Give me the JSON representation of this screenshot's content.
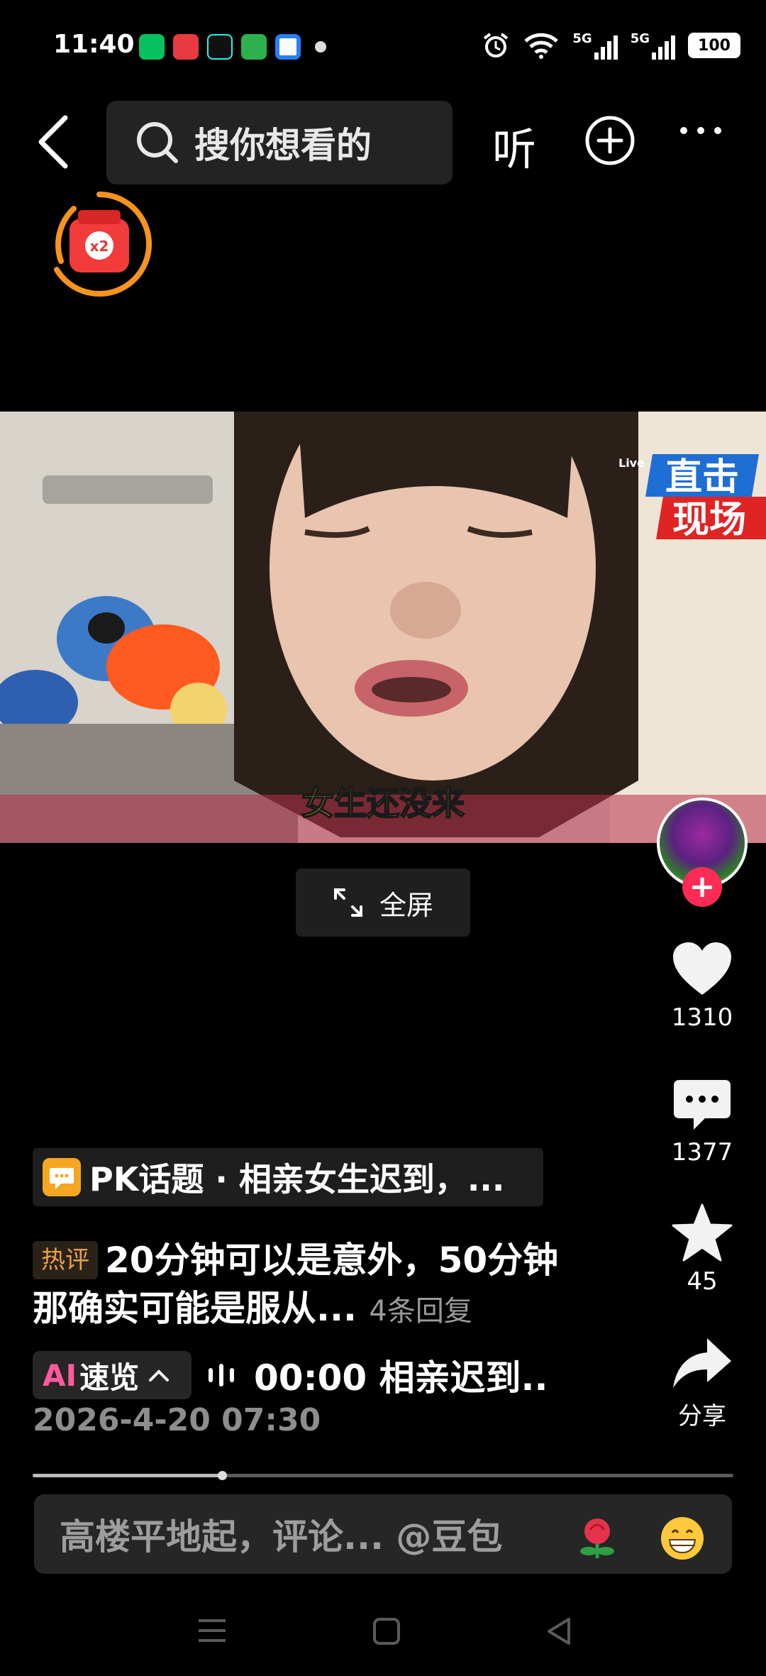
{
  "status_bar": {
    "time": "11:40",
    "battery": "100",
    "network_1": "5G",
    "network_2": "5G"
  },
  "top_nav": {
    "search_label": "搜你想看的",
    "listen_label": "听"
  },
  "redpacket": {
    "multiplier": "x2"
  },
  "video": {
    "caption": "女生还没来",
    "banner_line1": "直击",
    "banner_line2": "现场",
    "live_tag": "Live"
  },
  "fullscreen": {
    "label": "全屏"
  },
  "rail": {
    "likes": "1310",
    "comments": "1377",
    "favorites": "45",
    "share_label": "分享"
  },
  "info": {
    "topic": "PK话题 · 相亲女生迟到，...",
    "hot_badge": "热评",
    "hot_comment": "20分钟可以是意外，50分钟那确实可能是服从...",
    "reply_count": "4条回复",
    "ai_label": "AI",
    "ai_text": "速览",
    "summary": "00:00 相亲迟到..",
    "timestamp": "2026-4-20 07:30",
    "progress": 0.27
  },
  "comment_bar": {
    "placeholder": "高楼平地起，评论... @豆包"
  },
  "colors": {
    "accent_red": "#fe2c55",
    "ring_orange": "#f7941d"
  }
}
